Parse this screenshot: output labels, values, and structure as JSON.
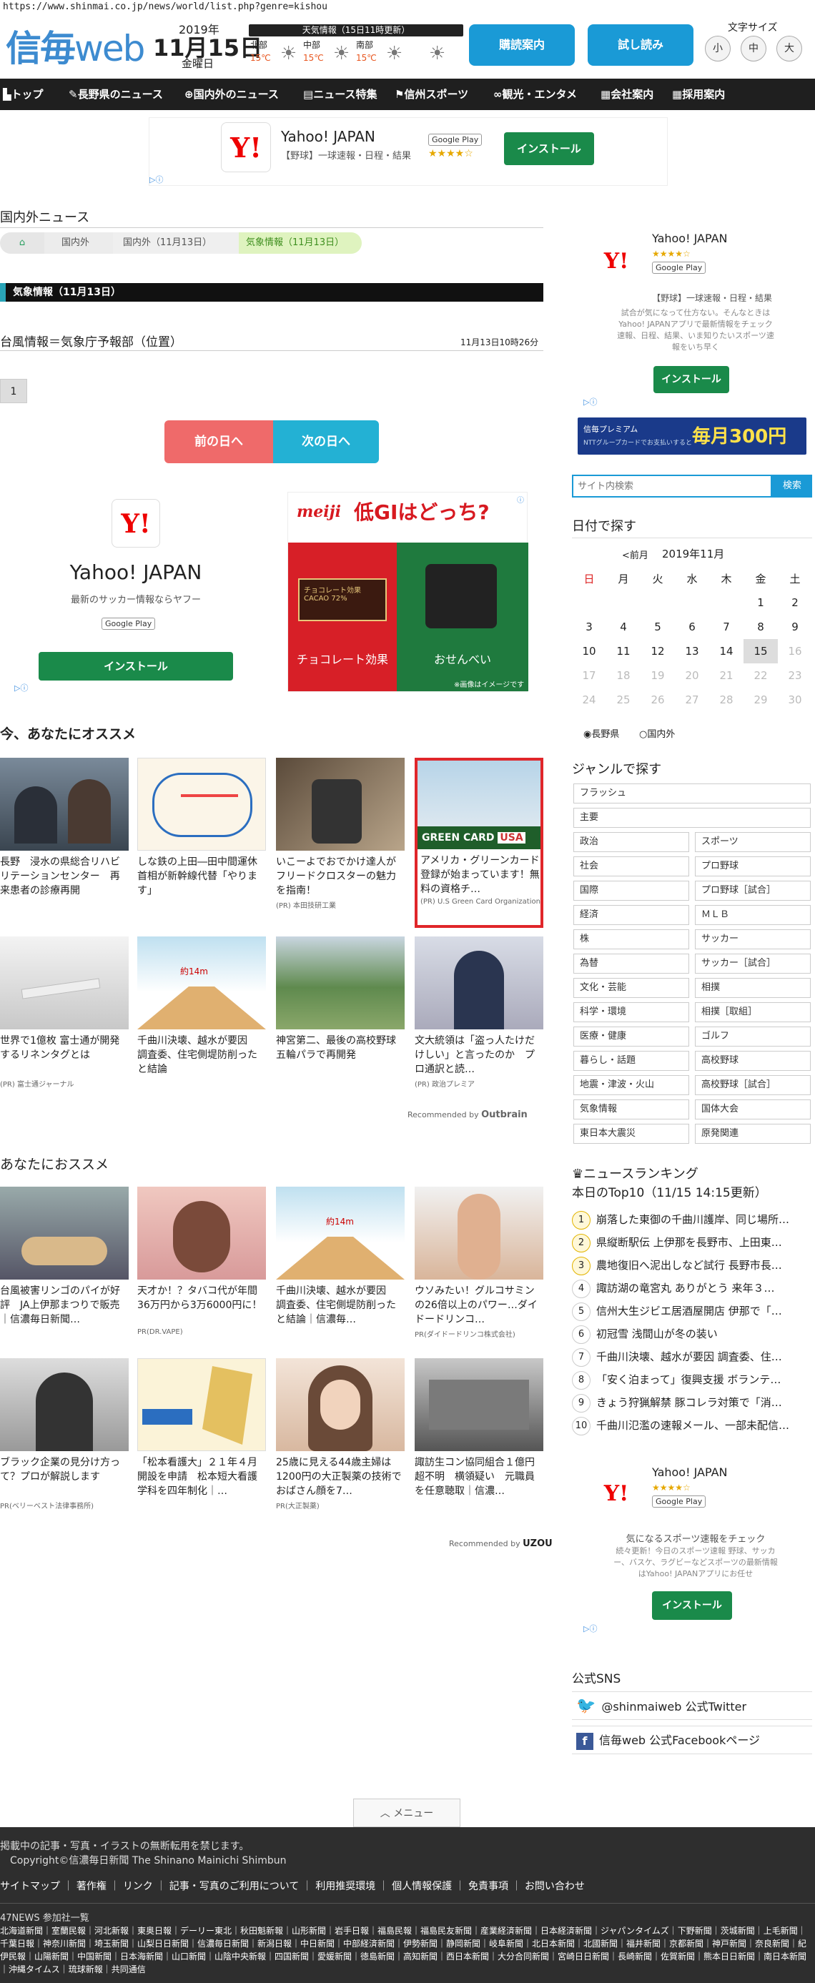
{
  "url": "https://www.shinmai.co.jp/news/world/list.php?genre=kishou",
  "logo": {
    "bold": "信毎",
    "thin": "web"
  },
  "date": {
    "year": "2019年",
    "md": "11月15日",
    "dow": "金曜日"
  },
  "weather": {
    "header": "天気情報（15日11時更新）",
    "cells": [
      {
        "name": "北部",
        "temp": "15℃"
      },
      {
        "name": "中部",
        "temp": "15℃"
      },
      {
        "name": "南部",
        "temp": "15℃"
      }
    ]
  },
  "buttons": {
    "subscribe": "購読案内",
    "trial": "試し読み"
  },
  "fontsize": {
    "label": "文字サイズ",
    "small": "小",
    "mid": "中",
    "large": "大"
  },
  "nav": [
    "トップ",
    "長野県のニュース",
    "国内外のニュース",
    "ニュース特集",
    "信州スポーツ",
    "観光・エンタメ",
    "会社案内",
    "採用案内"
  ],
  "ad_top": {
    "name": "Yahoo! JAPAN",
    "sub": "【野球】一球速報・日程・結果",
    "store": "Google Play",
    "install": "インストール",
    "stars": "★★★★☆"
  },
  "section_title": "国内外ニュース",
  "breadcrumb": [
    "国内外",
    "国内外（11月13日）",
    "気象情報（11月13日）"
  ],
  "category_title": "気象情報（11月13日）",
  "article": {
    "title": "台風情報＝気象庁予報部（位置）",
    "time": "11月13日10時26分"
  },
  "page_num": "1",
  "prev_day": "前の日へ",
  "next_day": "次の日へ",
  "ad_mid": {
    "name": "Yahoo! JAPAN",
    "sub": "最新のサッカー情報ならヤフー",
    "store": "Google Play",
    "install": "インストール"
  },
  "meiji": {
    "brand": "meiji",
    "headline": "低GIはどっち?",
    "left": "チョコレート効果",
    "right": "おせんべい",
    "note": "※画像はイメージです",
    "pkg": "チョコレート効果 CACAO 72%"
  },
  "recommend1": {
    "title": "今、あなたにオススメ",
    "cards": [
      {
        "cap": "長野　浸水の県総合リハビリテーションセンター　再来患者の診療再開",
        "pr": ""
      },
      {
        "cap": "しな鉄の上田―田中間運休　首相が新幹線代替「やります」",
        "pr": ""
      },
      {
        "cap": "いこーよでおでかけ達人がフリードクロスターの魅力を指南！",
        "pr": "(PR) 本田技研工業"
      },
      {
        "cap": "アメリカ・グリーンカード登録が始まっています！無料の資格チ…",
        "pr": "(PR) U.S Green Card Organization"
      },
      {
        "cap": "世界で1億枚 富士通が開発するリネンタグとは",
        "pr": "(PR) 富士通ジャーナル"
      },
      {
        "cap": "千曲川決壊、越水が要因　調査委、住宅側堤防削ったと結論",
        "pr": ""
      },
      {
        "cap": "神宮第二、最後の高校野球　五輪パラで再開発",
        "pr": ""
      },
      {
        "cap": "文大統領は「盗っ人たけだけしい」と言ったのか　プロ通訳と読…",
        "pr": "(PR) 政治プレミア"
      }
    ],
    "provider": "Recommended by",
    "brand": "Outbrain"
  },
  "recommend2": {
    "title": "あなたにおススメ",
    "cards": [
      {
        "cap": "台風被害リンゴのパイが好評　JA上伊那まつりで販売｜信濃毎日新聞…",
        "pr": ""
      },
      {
        "cap": "天才か！？タバコ代が年間36万円から3万6000円に！",
        "pr": "PR(DR.VAPE)"
      },
      {
        "cap": "千曲川決壊、越水が要因　調査委、住宅側堤防削ったと結論｜信濃毎…",
        "pr": ""
      },
      {
        "cap": "ウソみたい！グルコサミンの26倍以上のパワー…ダイドードリンコ…",
        "pr": "PR(ダイドードリンコ株式会社)"
      },
      {
        "cap": "ブラック企業の見分け方って？プロが解説します",
        "pr": "PR(ベリーベスト法律事務所)"
      },
      {
        "cap": "「松本看護大」２１年４月開設を申請　松本短大看護学科を四年制化｜…",
        "pr": ""
      },
      {
        "cap": "25歳に見える44歳主婦は1200円の大正製薬の技術でおばさん顔を7…",
        "pr": "PR(大正製薬)"
      },
      {
        "cap": "諏訪生コン協同組合１億円超不明　横領疑い　元職員を任意聴取｜信濃…",
        "pr": ""
      }
    ],
    "provider": "Recommended by",
    "brand": "UZOU"
  },
  "ad_side1": {
    "name": "Yahoo! JAPAN",
    "stars": "★★★★☆",
    "store": "Google Play",
    "sub": "【野球】一球速報・日程・結果",
    "desc": "試合が気になって仕方ない。そんなときはYahoo! JAPANアプリで最新情報をチェック 速報、日程、結果、いま知りたいスポーツ速報をいち早く",
    "install": "インストール"
  },
  "banner": {
    "small": "信毎プレミアム",
    "line": "毎月300円",
    "note": "NTTグループカードでお支払いすると"
  },
  "search": {
    "placeholder": "サイト内検索",
    "button": "検索"
  },
  "calendar": {
    "title": "日付で探す",
    "prev": "<前月",
    "month": "2019年11月",
    "dows": [
      "日",
      "月",
      "火",
      "水",
      "木",
      "金",
      "土"
    ],
    "rows": [
      [
        "",
        "",
        "",
        "",
        "",
        "1",
        "2"
      ],
      [
        "3",
        "4",
        "5",
        "6",
        "7",
        "8",
        "9"
      ],
      [
        "10",
        "11",
        "12",
        "13",
        "14",
        "15",
        "16"
      ],
      [
        "17",
        "18",
        "19",
        "20",
        "21",
        "22",
        "23"
      ],
      [
        "24",
        "25",
        "26",
        "27",
        "28",
        "29",
        "30"
      ]
    ],
    "radio1": "長野県",
    "radio2": "国内外"
  },
  "genres": {
    "title": "ジャンルで探す",
    "full": [
      "フラッシュ",
      "主要"
    ],
    "pairs": [
      [
        "政治",
        "スポーツ"
      ],
      [
        "社会",
        "プロ野球"
      ],
      [
        "国際",
        "プロ野球［試合］"
      ],
      [
        "経済",
        "ＭＬＢ"
      ],
      [
        "株",
        "サッカー"
      ],
      [
        "為替",
        "サッカー［試合］"
      ],
      [
        "文化・芸能",
        "相撲"
      ],
      [
        "科学・環境",
        "相撲［取組］"
      ],
      [
        "医療・健康",
        "ゴルフ"
      ],
      [
        "暮らし・話題",
        "高校野球"
      ],
      [
        "地震・津波・火山",
        "高校野球［試合］"
      ],
      [
        "気象情報",
        "国体大会"
      ],
      [
        "東日本大震災",
        "原発関連"
      ]
    ]
  },
  "ranking": {
    "title": "ニュースランキング",
    "subtitle": "本日のTop10（11/15 14:15更新）",
    "items": [
      "崩落した東御の千曲川護岸、同じ場所…",
      "県縦断駅伝 上伊那を長野市、上田東…",
      "農地復旧へ泥出しなど試行 長野市長…",
      "諏訪湖の竜宮丸 ありがとう 来年３…",
      "信州大生ジビエ居酒屋開店 伊那で「…",
      "初冠雪 浅間山が冬の装い",
      "千曲川決壊、越水が要因 調査委、住…",
      "「安く泊まって」復興支援 ボランテ…",
      "きょう狩猟解禁 豚コレラ対策で「消…",
      "千曲川氾濫の速報メール、一部未配信…"
    ]
  },
  "ad_side2": {
    "name": "Yahoo! JAPAN",
    "stars": "★★★★☆",
    "store": "Google Play",
    "sub": "気になるスポーツ速報をチェック",
    "desc": "続々更新！今日のスポーツ速報 野球、サッカー、バスケ、ラグビーなどスポーツの最新情報はYahoo! JAPANアプリにお任せ",
    "install": "インストール"
  },
  "sns": {
    "title": "公式SNS",
    "twitter": "@shinmaiweb 公式Twitter",
    "facebook": "信毎web 公式Facebookページ"
  },
  "menu": "メニュー",
  "footer": {
    "notice": "掲載中の記事・写真・イラストの無断転用を禁じます。",
    "copy": "Copyright©信濃毎日新聞 The Shinano Mainichi Shimbun",
    "links": [
      "サイトマップ",
      "著作権",
      "リンク",
      "記事・写真のご利用について",
      "利用推奨環境",
      "個人情報保護",
      "免責事項",
      "お問い合わせ"
    ],
    "club": "47NEWS 参加社一覧",
    "papers": "北海道新聞｜室蘭民報｜河北新報｜東奥日報｜デーリー東北｜秋田魁新報｜山形新聞｜岩手日報｜福島民報｜福島民友新聞｜産業経済新聞｜日本経済新聞｜ジャパンタイムズ｜下野新聞｜茨城新聞｜上毛新聞｜千葉日報｜神奈川新聞｜埼玉新聞｜山梨日日新聞｜信濃毎日新聞｜新潟日報｜中日新聞｜中部経済新聞｜伊勢新聞｜静岡新聞｜岐阜新聞｜北日本新聞｜北國新聞｜福井新聞｜京都新聞｜神戸新聞｜奈良新聞｜紀伊民報｜山陽新聞｜中国新聞｜日本海新聞｜山口新聞｜山陰中央新報｜四国新聞｜愛媛新聞｜徳島新聞｜高知新聞｜西日本新聞｜大分合同新聞｜宮崎日日新聞｜長崎新聞｜佐賀新聞｜熊本日日新聞｜南日本新聞｜沖縄タイムス｜琉球新報｜共同通信"
  }
}
